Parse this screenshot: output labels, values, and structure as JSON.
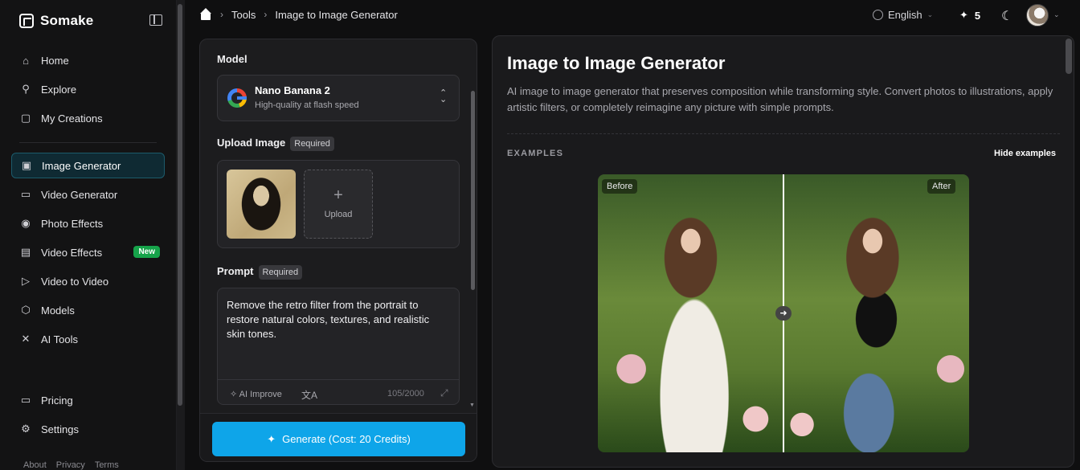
{
  "brand": {
    "name": "Somake"
  },
  "sidebar": {
    "items": [
      {
        "label": "Home",
        "icon": "home-icon"
      },
      {
        "label": "Explore",
        "icon": "search-icon"
      },
      {
        "label": "My Creations",
        "icon": "book-icon"
      },
      {
        "label": "Image Generator",
        "icon": "image-icon",
        "active": true
      },
      {
        "label": "Video Generator",
        "icon": "video-camera-icon"
      },
      {
        "label": "Photo Effects",
        "icon": "camera-icon"
      },
      {
        "label": "Video Effects",
        "icon": "film-icon",
        "badge": "New"
      },
      {
        "label": "Video to Video",
        "icon": "play-circle-icon"
      },
      {
        "label": "Models",
        "icon": "cube-icon"
      },
      {
        "label": "AI Tools",
        "icon": "tools-icon"
      }
    ],
    "bottom": [
      {
        "label": "Pricing",
        "icon": "card-icon"
      },
      {
        "label": "Settings",
        "icon": "gear-icon"
      }
    ],
    "footer": [
      "About",
      "Privacy",
      "Terms"
    ]
  },
  "breadcrumb": {
    "tools": "Tools",
    "current": "Image to Image Generator"
  },
  "topbar": {
    "language": "English",
    "credits": "5"
  },
  "form": {
    "model_label": "Model",
    "model_name": "Nano Banana 2",
    "model_sub": "High-quality at flash speed",
    "upload_label": "Upload Image",
    "required": "Required",
    "upload_text": "Upload",
    "prompt_label": "Prompt",
    "prompt_text": "Remove the retro filter from the portrait to restore natural colors, textures, and realistic skin tones.",
    "ai_improve": "AI Improve",
    "counter": "105/2000",
    "generate": "Generate (Cost: 20 Credits)"
  },
  "main": {
    "title": "Image to Image Generator",
    "description": "AI image to image generator that preserves composition while transforming style. Convert photos to illustrations, apply artistic filters, or completely reimagine any picture with simple prompts.",
    "examples_label": "EXAMPLES",
    "hide_examples": "Hide examples",
    "before": "Before",
    "after": "After"
  },
  "colors": {
    "accent": "#0ea5e9",
    "badge_new": "#16a34a",
    "active_bg": "#0f2a33"
  }
}
